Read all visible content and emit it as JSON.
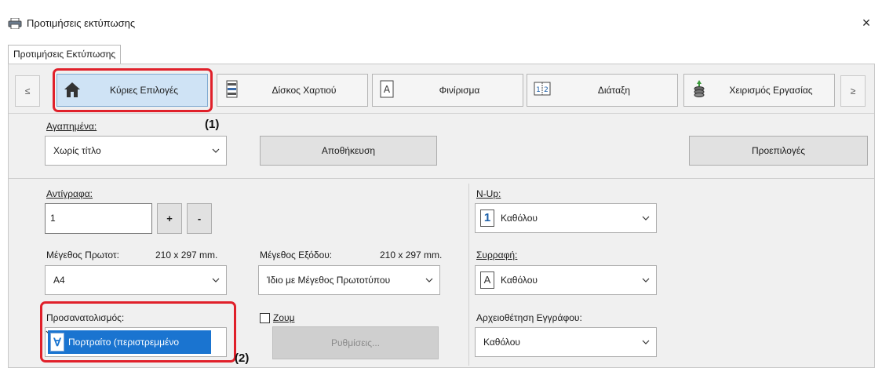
{
  "window": {
    "title": "Προτιμήσεις εκτύπωσης",
    "close_glyph": "×",
    "icon": "printer-icon"
  },
  "tabs": [
    {
      "label": "Προτιμήσεις Εκτύπωσης",
      "selected": true
    }
  ],
  "nav": {
    "prev_glyph": "≤",
    "next_glyph": "≥",
    "buttons": [
      {
        "label": "Κύριες Επιλογές",
        "icon": "house-icon",
        "active": true
      },
      {
        "label": "Δίσκος Χαρτιού",
        "icon": "paper-tray-icon",
        "active": false
      },
      {
        "label": "Φινίρισμα",
        "icon": "finishing-icon",
        "active": false
      },
      {
        "label": "Διάταξη",
        "icon": "layout-icon",
        "active": false
      },
      {
        "label": "Χειρισμός Εργασίας",
        "icon": "job-handling-icon",
        "active": false
      }
    ]
  },
  "callouts": {
    "one": "(1)",
    "two": "(2)"
  },
  "favorites": {
    "label": "Αγαπημένα:",
    "value": "Χωρίς τίτλο",
    "save_label": "Αποθήκευση",
    "defaults_label": "Προεπιλογές"
  },
  "copies": {
    "label": "Αντίγραφα:",
    "value": "1",
    "plus": "+",
    "minus": "-"
  },
  "original_size": {
    "label": "Μέγεθος Πρωτοτ:",
    "dims": "210 x 297 mm.",
    "value": "A4"
  },
  "output_size": {
    "label": "Μέγεθος Εξόδου:",
    "dims": "210 x 297 mm.",
    "value": "Ίδιο με Μέγεθος Πρωτοτύπου"
  },
  "orientation": {
    "label": "Προσανατολισμός:",
    "icon_glyph": "∀",
    "value": "Πορτραίτο (περιστρεμμένο"
  },
  "zoom": {
    "label": "Ζουμ",
    "checked": false,
    "settings_label": "Ρυθμίσεις..."
  },
  "nup": {
    "label": "N-Up:",
    "icon_glyph": "1",
    "value": "Καθόλου"
  },
  "staple": {
    "label": "Συρραφή:",
    "icon_glyph": "A",
    "value": "Καθόλου"
  },
  "document_filing": {
    "label": "Αρχειοθέτηση Εγγράφου:",
    "value": "Καθόλου"
  },
  "colors": {
    "highlight": "#e0202a",
    "selection": "#1a74d0",
    "active_tab": "#cfe3f5"
  }
}
